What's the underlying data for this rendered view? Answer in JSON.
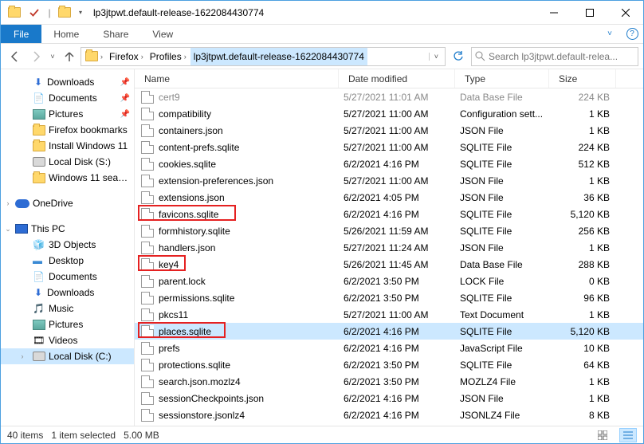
{
  "window": {
    "title": "lp3jtpwt.default-release-1622084430774"
  },
  "ribbon": {
    "file": "File",
    "tabs": [
      "Home",
      "Share",
      "View"
    ]
  },
  "breadcrumb": {
    "segments": [
      "Firefox",
      "Profiles"
    ],
    "current": "lp3jtpwt.default-release-1622084430774"
  },
  "search": {
    "placeholder": "Search lp3jtpwt.default-relea..."
  },
  "nav": {
    "downloads": "Downloads",
    "documents": "Documents",
    "pictures": "Pictures",
    "firefox_bm": "Firefox bookmarks",
    "install_win": "Install Windows 11",
    "local_s": "Local Disk (S:)",
    "win11": "Windows 11 search",
    "onedrive": "OneDrive",
    "this_pc": "This PC",
    "objects3d": "3D Objects",
    "desktop": "Desktop",
    "documents2": "Documents",
    "downloads2": "Downloads",
    "music": "Music",
    "pictures2": "Pictures",
    "videos": "Videos",
    "local_c": "Local Disk (C:)"
  },
  "columns": {
    "name": "Name",
    "date": "Date modified",
    "type": "Type",
    "size": "Size"
  },
  "files": [
    {
      "name": "cert9",
      "date": "5/27/2021 11:01 AM",
      "type": "Data Base File",
      "size": "224 KB",
      "highlight": false,
      "selected": false,
      "faded": true
    },
    {
      "name": "compatibility",
      "date": "5/27/2021 11:00 AM",
      "type": "Configuration sett...",
      "size": "1 KB",
      "highlight": false,
      "selected": false
    },
    {
      "name": "containers.json",
      "date": "5/27/2021 11:00 AM",
      "type": "JSON File",
      "size": "1 KB",
      "highlight": false,
      "selected": false
    },
    {
      "name": "content-prefs.sqlite",
      "date": "5/27/2021 11:00 AM",
      "type": "SQLITE File",
      "size": "224 KB",
      "highlight": false,
      "selected": false
    },
    {
      "name": "cookies.sqlite",
      "date": "6/2/2021 4:16 PM",
      "type": "SQLITE File",
      "size": "512 KB",
      "highlight": false,
      "selected": false
    },
    {
      "name": "extension-preferences.json",
      "date": "5/27/2021 11:00 AM",
      "type": "JSON File",
      "size": "1 KB",
      "highlight": false,
      "selected": false
    },
    {
      "name": "extensions.json",
      "date": "6/2/2021 4:05 PM",
      "type": "JSON File",
      "size": "36 KB",
      "highlight": false,
      "selected": false
    },
    {
      "name": "favicons.sqlite",
      "date": "6/2/2021 4:16 PM",
      "type": "SQLITE File",
      "size": "5,120 KB",
      "highlight": true,
      "selected": false
    },
    {
      "name": "formhistory.sqlite",
      "date": "5/26/2021 11:59 AM",
      "type": "SQLITE File",
      "size": "256 KB",
      "highlight": false,
      "selected": false
    },
    {
      "name": "handlers.json",
      "date": "5/27/2021 11:24 AM",
      "type": "JSON File",
      "size": "1 KB",
      "highlight": false,
      "selected": false
    },
    {
      "name": "key4",
      "date": "5/26/2021 11:45 AM",
      "type": "Data Base File",
      "size": "288 KB",
      "highlight": true,
      "selected": false
    },
    {
      "name": "parent.lock",
      "date": "6/2/2021 3:50 PM",
      "type": "LOCK File",
      "size": "0 KB",
      "highlight": false,
      "selected": false
    },
    {
      "name": "permissions.sqlite",
      "date": "6/2/2021 3:50 PM",
      "type": "SQLITE File",
      "size": "96 KB",
      "highlight": false,
      "selected": false
    },
    {
      "name": "pkcs11",
      "date": "5/27/2021 11:00 AM",
      "type": "Text Document",
      "size": "1 KB",
      "highlight": false,
      "selected": false
    },
    {
      "name": "places.sqlite",
      "date": "6/2/2021 4:16 PM",
      "type": "SQLITE File",
      "size": "5,120 KB",
      "highlight": true,
      "selected": true
    },
    {
      "name": "prefs",
      "date": "6/2/2021 4:16 PM",
      "type": "JavaScript File",
      "size": "10 KB",
      "highlight": false,
      "selected": false
    },
    {
      "name": "protections.sqlite",
      "date": "6/2/2021 3:50 PM",
      "type": "SQLITE File",
      "size": "64 KB",
      "highlight": false,
      "selected": false
    },
    {
      "name": "search.json.mozlz4",
      "date": "6/2/2021 3:50 PM",
      "type": "MOZLZ4 File",
      "size": "1 KB",
      "highlight": false,
      "selected": false
    },
    {
      "name": "sessionCheckpoints.json",
      "date": "6/2/2021 4:16 PM",
      "type": "JSON File",
      "size": "1 KB",
      "highlight": false,
      "selected": false
    },
    {
      "name": "sessionstore.jsonlz4",
      "date": "6/2/2021 4:16 PM",
      "type": "JSONLZ4 File",
      "size": "8 KB",
      "highlight": false,
      "selected": false
    }
  ],
  "status": {
    "count": "40 items",
    "selected": "1 item selected",
    "size": "5.00 MB"
  }
}
